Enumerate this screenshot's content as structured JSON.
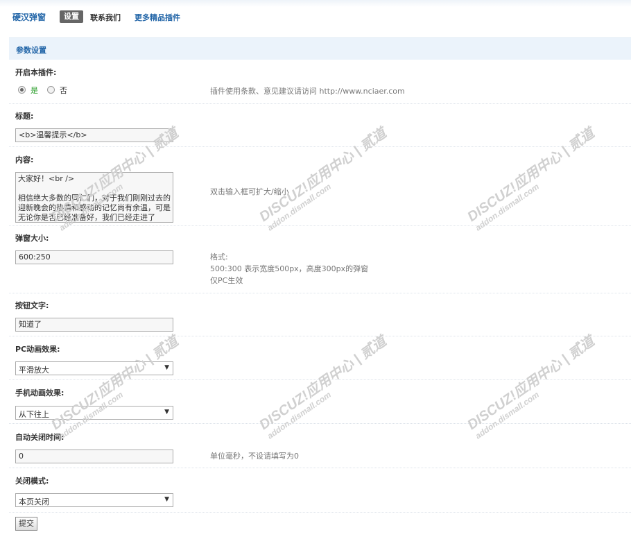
{
  "header": {
    "brand": "硬汉弹窗",
    "tab_active": "设置",
    "tab_contact": "联系我们",
    "tab_more": "更多精品插件"
  },
  "section": {
    "title": "参数设置"
  },
  "fields": {
    "enable": {
      "label": "开启本插件:",
      "option_yes": "是",
      "option_no": "否",
      "selected": "是",
      "note": "插件使用条款、意见建议请访问 http://www.nciaer.com"
    },
    "title": {
      "label": "标题:",
      "value": "<b>温馨提示</b>"
    },
    "content": {
      "label": "内容:",
      "value": "大家好！<br />\n\n相信绝大多数的同仁们，对于我们刚刚过去的迎新晚会的热情和感动的记忆尚有余温，可是无论你是否已经准备好，我们已经走进了",
      "note": "双击输入框可扩大/缩小"
    },
    "size": {
      "label": "弹窗大小:",
      "value": "600:250",
      "note_line1": "格式:",
      "note_line2": "500:300 表示宽度500px，高度300px的弹窗",
      "note_line3": "仅PC生效"
    },
    "button_text": {
      "label": "按钮文字:",
      "value": "知道了"
    },
    "pc_anim": {
      "label": "PC动画效果:",
      "value": "平滑放大"
    },
    "mobile_anim": {
      "label": "手机动画效果:",
      "value": "从下往上"
    },
    "auto_close": {
      "label": "自动关闭时间:",
      "value": "0",
      "note": "单位毫秒，不设请填写为0"
    },
    "close_mode": {
      "label": "关闭模式:",
      "value": "本页关闭"
    }
  },
  "submit_label": "提交",
  "watermark": {
    "line1": "DISCUZ!应用中心 | 贰道",
    "line2": "addon.dismall.com"
  },
  "colors": {
    "accent": "#2366a8",
    "header_bg": "#ebf3fb",
    "yes_green": "#2a9d2a"
  }
}
